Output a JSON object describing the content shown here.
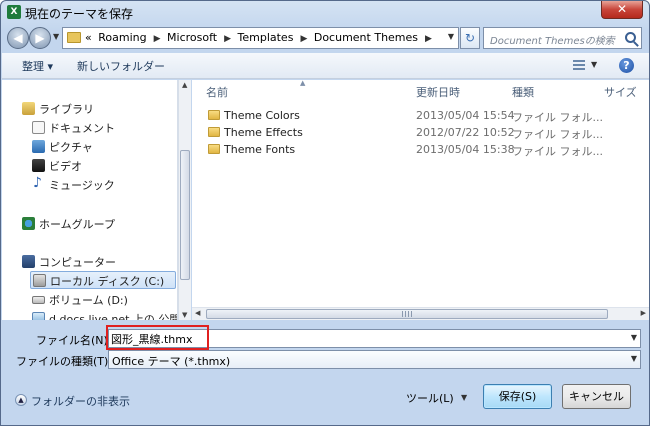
{
  "window": {
    "title": "現在のテーマを保存",
    "app_icon": "X"
  },
  "address_bar": {
    "overflow": "«",
    "crumbs": [
      "Roaming",
      "Microsoft",
      "Templates",
      "Document Themes"
    ],
    "search_placeholder": "Document Themesの検索"
  },
  "toolbar": {
    "organize_label": "整理 ▾",
    "new_folder_label": "新しいフォルダー"
  },
  "nav": {
    "libraries": "ライブラリ",
    "documents": "ドキュメント",
    "pictures": "ピクチャ",
    "videos": "ビデオ",
    "music": "ミュージック",
    "homegroup": "ホームグループ",
    "computer": "コンピューター",
    "local_disk": "ローカル ディスク (C:)",
    "volume": "ボリューム (D:)",
    "network": "d.docs.live.net 上の 公開"
  },
  "columns": {
    "name": "名前",
    "date": "更新日時",
    "type": "種類",
    "size": "サイズ"
  },
  "files": [
    {
      "name": "Theme Colors",
      "date": "2013/05/04 15:54",
      "type": "ファイル フォル..."
    },
    {
      "name": "Theme Effects",
      "date": "2012/07/22 10:52",
      "type": "ファイル フォル..."
    },
    {
      "name": "Theme Fonts",
      "date": "2013/05/04 15:38",
      "type": "ファイル フォル..."
    }
  ],
  "form": {
    "filename_label": "ファイル名(N):",
    "filename_value": "図形_黒線.thmx",
    "filetype_label": "ファイルの種類(T):",
    "filetype_value": "Office テーマ (*.thmx)"
  },
  "footer": {
    "hide_folders": "フォルダーの非表示",
    "tools": "ツール(L)",
    "save": "保存(S)",
    "cancel": "キャンセル"
  },
  "colors": {
    "highlight": "#e02020",
    "accent": "#3c7fb1"
  }
}
